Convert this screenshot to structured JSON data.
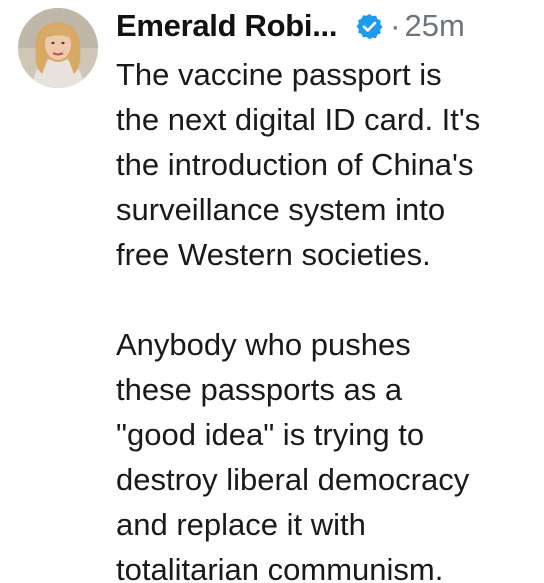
{
  "tweet": {
    "display_name": "Emerald Robi...",
    "separator": "·",
    "timestamp": "25m",
    "paragraphs": [
      "The vaccine passport is\nthe next digital ID card. It's\nthe introduction of China's\nsurveillance system into\nfree Western societies.",
      "Anybody who pushes\nthese passports as a\n\"good idea\" is trying to\ndestroy liberal democracy\nand replace it with\ntotalitarian communism."
    ],
    "avatar_icon": "profile-photo",
    "verified_icon": "verified-badge-icon"
  },
  "colors": {
    "verified": "#1d9bf0",
    "muted": "#6e767d",
    "text": "#1a1a1a"
  }
}
